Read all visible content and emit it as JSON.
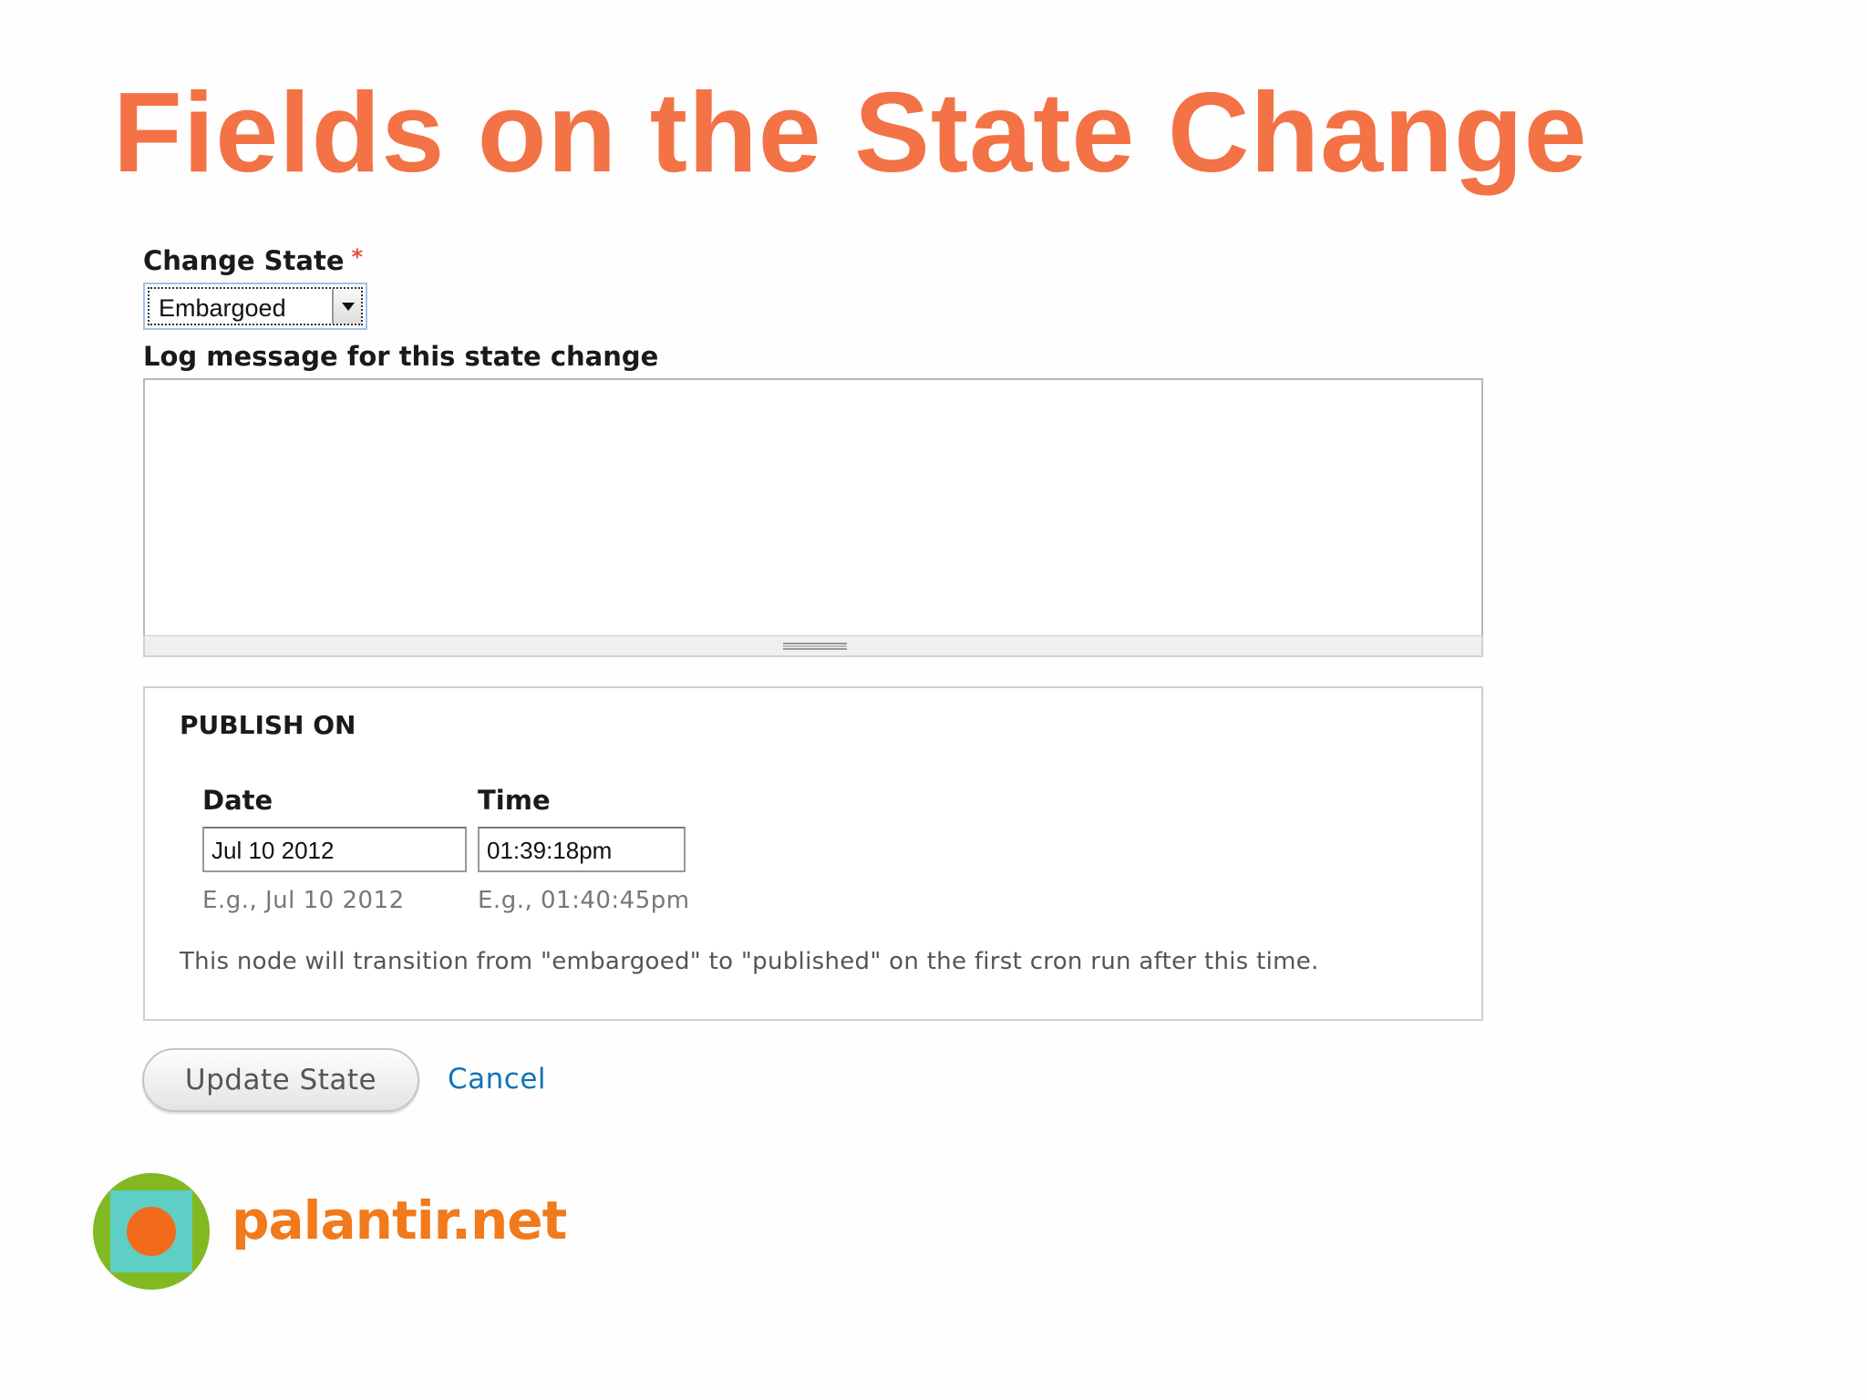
{
  "slide": {
    "title": "Fields on the State Change"
  },
  "form": {
    "change_state": {
      "label": "Change State",
      "required_marker": "*",
      "selected_value": "Embargoed"
    },
    "log_message": {
      "label": "Log message for this state change",
      "value": ""
    },
    "publish_on": {
      "legend": "PUBLISH ON",
      "date": {
        "label": "Date",
        "value": "Jul 10 2012",
        "hint": "E.g., Jul 10 2012"
      },
      "time": {
        "label": "Time",
        "value": "01:39:18pm",
        "hint": "E.g., 01:40:45pm"
      },
      "description": "This node will transition from \"embargoed\" to \"published\" on the first cron run after this time."
    },
    "submit_label": "Update State",
    "cancel_label": "Cancel"
  },
  "branding": {
    "logo_icon": "palantir-logo-icon",
    "name": "palantir.net",
    "colors": {
      "title": "#f37246",
      "brand_text": "#f07a1c",
      "logo_outer": "#82b822",
      "logo_square": "#5ecfc4",
      "logo_dot": "#f26b1d",
      "link": "#0f73b8"
    }
  }
}
